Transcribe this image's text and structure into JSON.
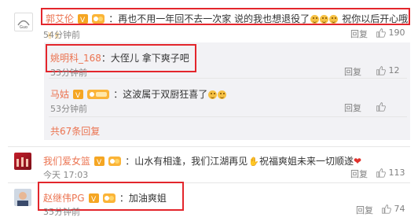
{
  "comments": [
    {
      "user": "郭艾伦",
      "text": "：再也不用一年回不去一次家 说的我也想退役了",
      "text_tail": "祝你以后开心哦",
      "time": "54分钟前",
      "reply": "回复",
      "likes": "190"
    },
    {
      "user": "姚明科_168",
      "text": "：大侄儿 拿下爽子吧",
      "time": "33分钟前",
      "reply": "回复",
      "likes": "12"
    },
    {
      "user": "马姑",
      "text": "：这波属于双厨狂喜了",
      "time": "53分钟前",
      "reply": "回复",
      "likes_icon": "like-icon"
    },
    {
      "user": "我们爱女篮",
      "text": "：山水有相逢，我们江湖再见",
      "text_tail": "祝福爽姐未来一切顺遂",
      "time": "今天 17:03",
      "reply": "回复",
      "likes": "113"
    },
    {
      "user": "赵继伟PG",
      "text": "：加油爽姐",
      "time": "35分钟前",
      "reply": "回复",
      "likes": "74"
    }
  ],
  "more_replies": "共67条回复",
  "colors": {
    "username": "#eb7350",
    "highlight_box": "#e3262c",
    "reply_bg": "#f2f2f5"
  }
}
